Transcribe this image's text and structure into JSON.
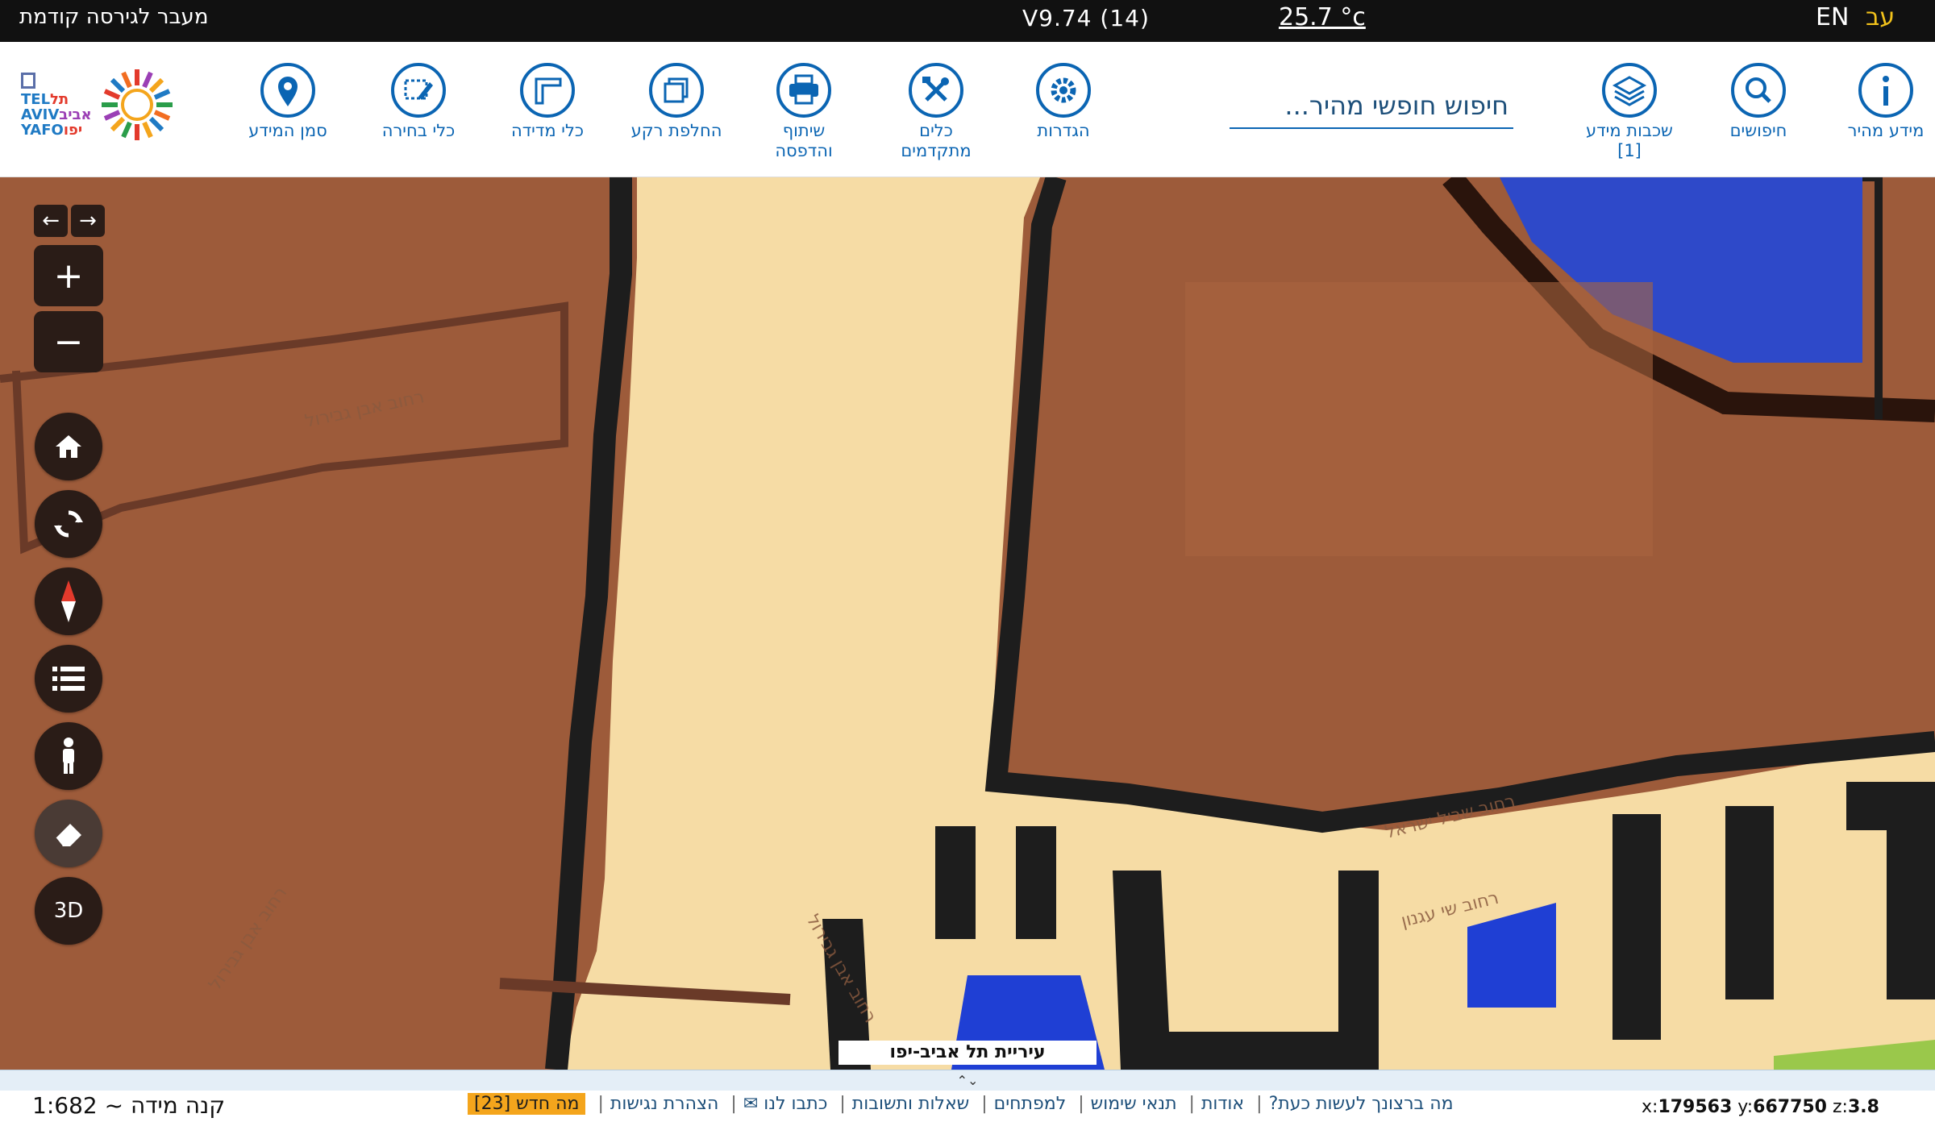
{
  "topbar": {
    "prev_version": "מעבר לגירסה קודמת",
    "version": "V9.74 (14)",
    "temperature": "25.7 °c",
    "lang_en": "EN",
    "lang_he": "עב"
  },
  "logo": {
    "line1": "תל",
    "line1_en": "TEL",
    "line2": "אביב",
    "line2_en": "AVIV",
    "line3": "יפו",
    "line3_en": "YAFO"
  },
  "tools": {
    "quick_info": "מידע מהיר",
    "searches": "חיפושים",
    "layers_line1": "שכבות מידע",
    "layers_line2": "[1]",
    "settings": "הגדרות",
    "advanced_line1": "כלים",
    "advanced_line2": "מתקדמים",
    "share_line1": "שיתוף",
    "share_line2": "והדפסה",
    "basemap": "החלפת רקע",
    "measure": "כלי מדידה",
    "selection": "כלי בחירה",
    "info_marker": "סמן המידע"
  },
  "search": {
    "placeholder": "חיפוש חופשי מהיר..."
  },
  "map": {
    "streets": [
      "רחוב אבן גבירול",
      "רחוב אבן גבירול",
      "רחוב אבן גבירול",
      "רחוב שביל ישראל",
      "רחוב שי עגנון"
    ],
    "city_footer": "עיריית תל אביב-יפו"
  },
  "controls": {
    "back": "←",
    "forward": "→",
    "zoom_in": "+",
    "zoom_out": "−",
    "three_d": "3D"
  },
  "bottom": {
    "handle": "⌃⌄",
    "scale": "קנה מידה ~ 1:682",
    "links": [
      "מה ברצונך לעשות כעת?",
      "אודות",
      "תנאי שימוש",
      "למפתחים",
      "שאלות ותשובות",
      "כתבו לנו ✉",
      "הצהרת נגישות"
    ],
    "whats_new": "מה חדש [23]",
    "coords_x_label": "x:",
    "coords_x": "179563",
    "coords_y_label": "y:",
    "coords_y": "667750",
    "coords_z_label": "z:",
    "coords_z": "3.8"
  },
  "colors": {
    "accent": "#0b65b3",
    "map_brown": "#9d5b3a",
    "map_beige": "#f6dca5",
    "control_bg": "#2a1c17",
    "badge": "#f4a51c"
  },
  "icons": [
    "info-icon",
    "search-icon",
    "layers-icon",
    "gear-icon",
    "tools-icon",
    "printer-icon",
    "basemap-icon",
    "ruler-icon",
    "select-icon",
    "pin-icon",
    "home-icon",
    "refresh-icon",
    "compass-icon",
    "list-icon",
    "person-icon",
    "eraser-icon"
  ]
}
